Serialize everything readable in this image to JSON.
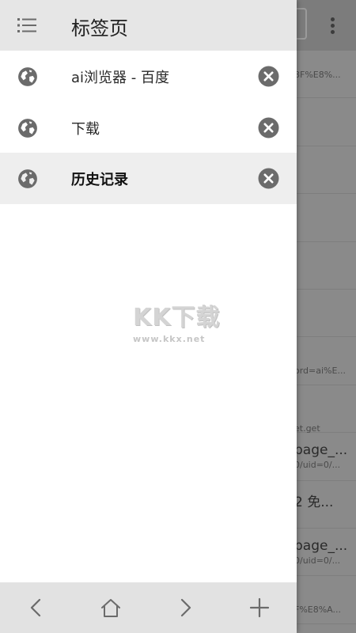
{
  "drawer": {
    "title": "标签页",
    "tabs": [
      {
        "label": "ai浏览器 - 百度",
        "active": false
      },
      {
        "label": "下载",
        "active": false
      },
      {
        "label": "历史记录",
        "active": true
      }
    ]
  },
  "watermark": {
    "logo": "KK下载",
    "url": "www.kkx.net"
  },
  "background": {
    "rows": [
      {
        "title": "",
        "subtitle": "8F%E8%..."
      },
      {
        "title": "",
        "subtitle": ""
      },
      {
        "title": "",
        "subtitle": ""
      },
      {
        "title": "",
        "subtitle": ""
      },
      {
        "title": "",
        "subtitle": ""
      },
      {
        "title": "",
        "subtitle": ""
      },
      {
        "title": "",
        "subtitle": "ord=ai%E..."
      },
      {
        "title": "",
        "subtitle": "et.get"
      },
      {
        "title": "page_...",
        "subtitle": "0/uid=0/..."
      },
      {
        "title": "2 免...",
        "subtitle": ""
      },
      {
        "title": "page_...",
        "subtitle": "0/uid=0/..."
      },
      {
        "title": "",
        "subtitle": "F%E8%A..."
      }
    ]
  },
  "icons": {
    "menu": "list-icon",
    "tab": "globe-icon",
    "close": "close-circle-icon",
    "back": "chevron-left-icon",
    "home": "home-icon",
    "forward": "chevron-right-icon",
    "add": "plus-icon"
  },
  "colors": {
    "drawer_header": "#e6e6e6",
    "active_tab": "#eeeeee",
    "icon_gray": "#6b6b6b",
    "overlay": "#8a8a8a"
  }
}
